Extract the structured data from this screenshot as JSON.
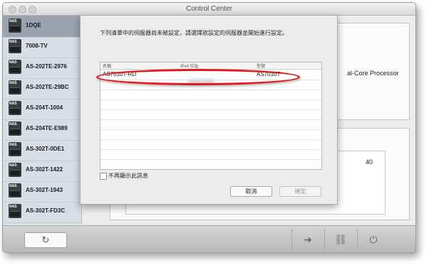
{
  "window": {
    "title": "Control Center"
  },
  "sidebar": {
    "items": [
      {
        "label": "1DQE",
        "badge": "NAS",
        "selected": true
      },
      {
        "label": "7008-TV",
        "badge": "NAS",
        "selected": false
      },
      {
        "label": "AS-202TE-2976",
        "badge": "NAS",
        "selected": false
      },
      {
        "label": "AS-202TE-29BC",
        "badge": "NAS",
        "selected": false
      },
      {
        "label": "AS-204T-1004",
        "badge": "NAS",
        "selected": false
      },
      {
        "label": "AS-204TE-E989",
        "badge": "NAS",
        "selected": false
      },
      {
        "label": "AS-302T-0DE1",
        "badge": "NAS",
        "selected": false
      },
      {
        "label": "AS-302T-1422",
        "badge": "NAS",
        "selected": false
      },
      {
        "label": "AS-302T-1943",
        "badge": "NAS",
        "selected": false
      },
      {
        "label": "AS-302T-FD3C",
        "badge": "NAS",
        "selected": false
      }
    ]
  },
  "background": {
    "cpu_text": "al-Core Processor",
    "value_text": "40"
  },
  "dialog": {
    "message": "下列清單中的伺服器尚未被設定，請選擇欲設定的伺服器並開始進行設定。",
    "columns": [
      "名稱",
      "IPv4 位址",
      "型號"
    ],
    "rows": [
      {
        "name": "AS7010T-RD",
        "ip": "",
        "model": "AS7010T"
      }
    ],
    "checkbox_label": "不再顯示此訊息",
    "checkbox_checked": false,
    "cancel_label": "取消",
    "confirm_label": "確定",
    "highlight_color": "#e3181b"
  },
  "toolbar": {
    "refresh_icon": "↻",
    "arrow_icon": "➜",
    "link_icon": "⛓",
    "power_icon": "⏻"
  }
}
